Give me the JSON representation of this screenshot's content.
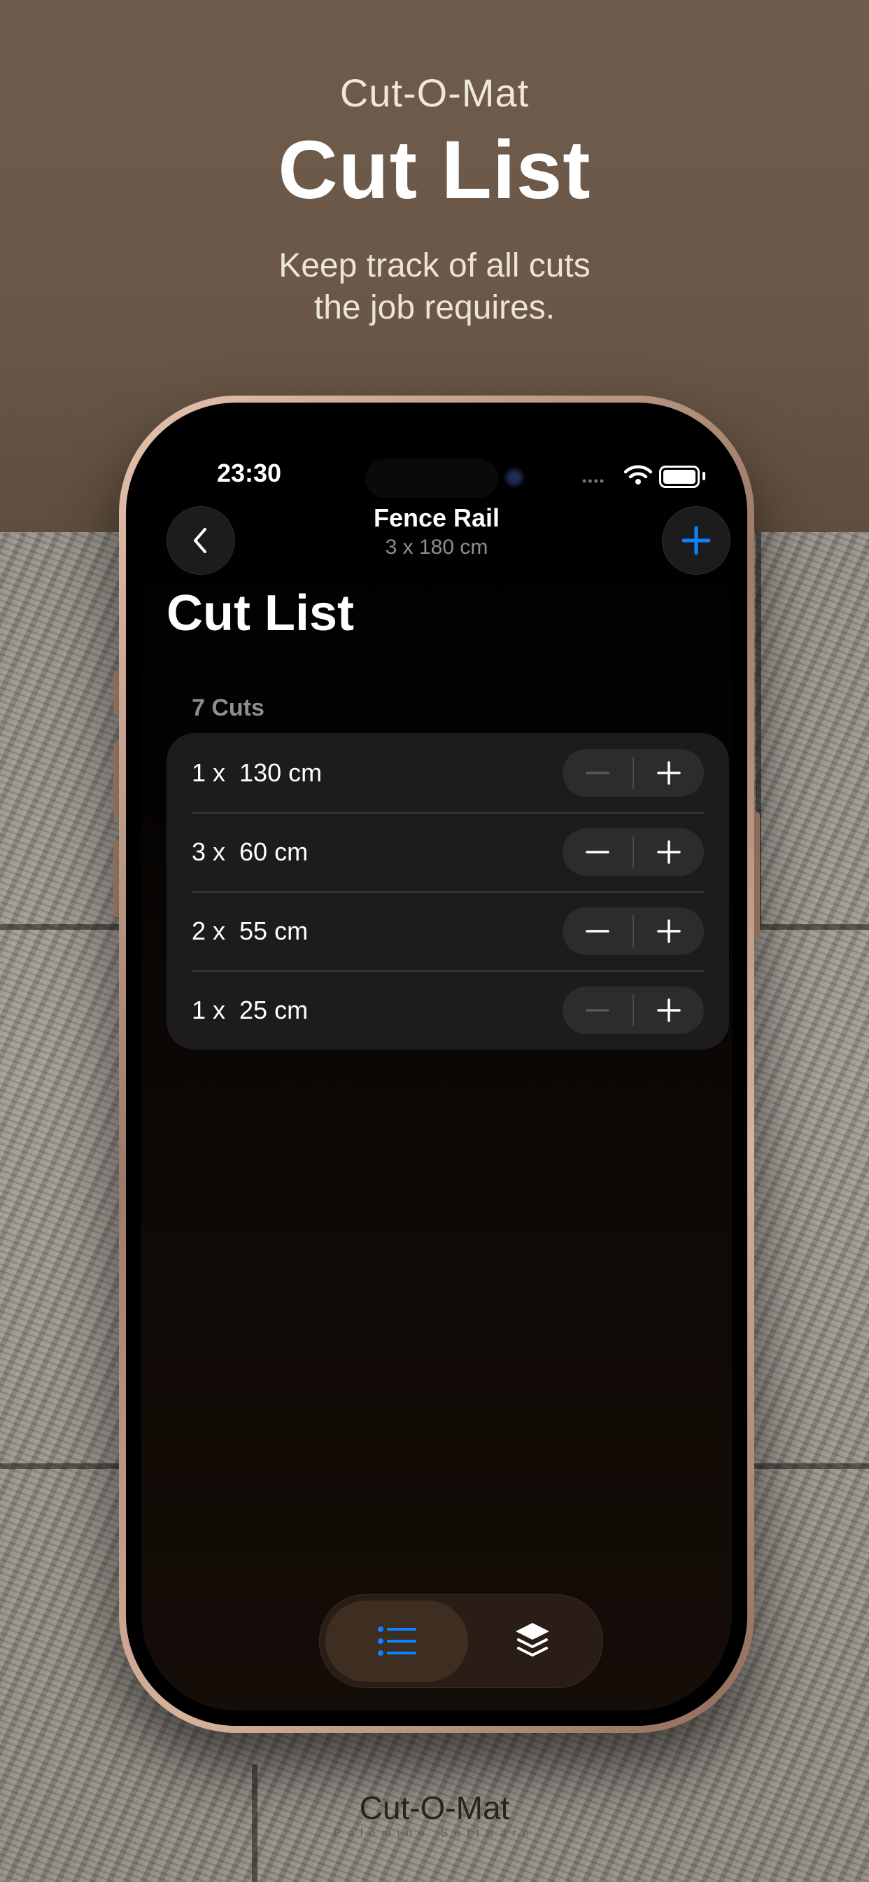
{
  "hero": {
    "app_name": "Cut-O-Mat",
    "title": "Cut List",
    "subtitle_line1": "Keep track of all cuts",
    "subtitle_line2": "the job requires."
  },
  "status_bar": {
    "time": "23:30"
  },
  "nav": {
    "title": "Fence Rail",
    "subtitle": "3 x 180 cm",
    "back_icon": "chevron-left-icon",
    "add_icon": "plus-icon"
  },
  "page_title": "Cut List",
  "section": {
    "header": "7 Cuts",
    "cuts": [
      {
        "label": "1 x  130 cm",
        "minus_enabled": false
      },
      {
        "label": "3 x  60 cm",
        "minus_enabled": true
      },
      {
        "label": "2 x  55 cm",
        "minus_enabled": true
      },
      {
        "label": "1 x  25 cm",
        "minus_enabled": false
      }
    ]
  },
  "tab_bar": {
    "tabs": [
      {
        "icon": "list-icon",
        "selected": true
      },
      {
        "icon": "layers-icon",
        "selected": false
      }
    ]
  },
  "footer": {
    "app_name": "Cut-O-Mat",
    "brand": "Palomino Software"
  },
  "colors": {
    "accent": "#0a84ff",
    "disabled": "#5a5a5e"
  }
}
